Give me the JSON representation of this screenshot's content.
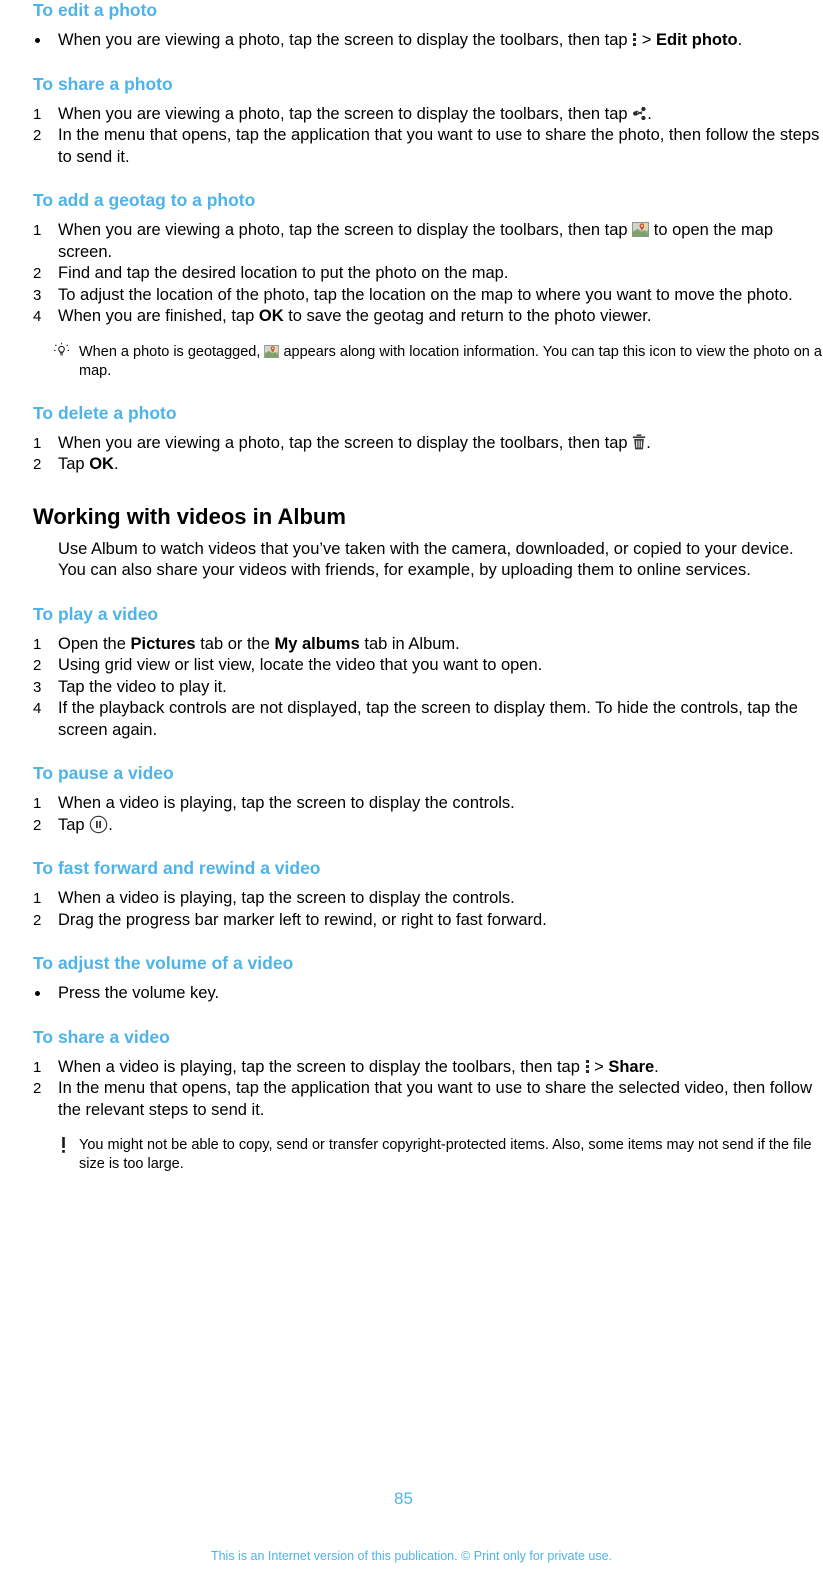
{
  "sections": [
    {
      "id": "edit-photo",
      "heading": "To edit a photo",
      "items": [
        {
          "marker": "bullet",
          "segments": [
            {
              "t": "text",
              "v": "When you are viewing a photo, tap the screen to display the toolbars, then tap "
            },
            {
              "t": "icon",
              "v": "kebab-menu-icon"
            },
            {
              "t": "text",
              "v": " > "
            },
            {
              "t": "bold",
              "v": "Edit photo"
            },
            {
              "t": "text",
              "v": "."
            }
          ]
        }
      ]
    },
    {
      "id": "share-photo",
      "heading": "To share a photo",
      "items": [
        {
          "marker": "1",
          "segments": [
            {
              "t": "text",
              "v": "When you are viewing a photo, tap the screen to display the toolbars, then tap "
            },
            {
              "t": "icon",
              "v": "share-icon"
            },
            {
              "t": "text",
              "v": "."
            }
          ]
        },
        {
          "marker": "2",
          "segments": [
            {
              "t": "text",
              "v": "In the menu that opens, tap the application that you want to use to share the photo, then follow the steps to send it."
            }
          ]
        }
      ]
    },
    {
      "id": "geotag-photo",
      "heading": "To add a geotag to a photo",
      "items": [
        {
          "marker": "1",
          "segments": [
            {
              "t": "text",
              "v": "When you are viewing a photo, tap the screen to display the toolbars, then tap "
            },
            {
              "t": "icon",
              "v": "map-pin-icon"
            },
            {
              "t": "text",
              "v": " to open the map screen."
            }
          ]
        },
        {
          "marker": "2",
          "segments": [
            {
              "t": "text",
              "v": "Find and tap the desired location to put the photo on the map."
            }
          ]
        },
        {
          "marker": "3",
          "segments": [
            {
              "t": "text",
              "v": "To adjust the location of the photo, tap the location on the map to where you want to move the photo."
            }
          ]
        },
        {
          "marker": "4",
          "segments": [
            {
              "t": "text",
              "v": "When you are finished, tap "
            },
            {
              "t": "bold",
              "v": "OK"
            },
            {
              "t": "text",
              "v": " to save the geotag and return to the photo viewer."
            }
          ]
        }
      ],
      "note": {
        "type": "tip",
        "glyph": "lightbulb-icon",
        "segments": [
          {
            "t": "text",
            "v": "When a photo is geotagged, "
          },
          {
            "t": "icon",
            "v": "map-pin-icon-small"
          },
          {
            "t": "text",
            "v": " appears along with location information. You can tap this icon to view the photo on a map."
          }
        ]
      }
    },
    {
      "id": "delete-photo",
      "heading": "To delete a photo",
      "items": [
        {
          "marker": "1",
          "segments": [
            {
              "t": "text",
              "v": "When you are viewing a photo, tap the screen to display the toolbars, then tap "
            },
            {
              "t": "icon",
              "v": "trash-icon"
            },
            {
              "t": "text",
              "v": "."
            }
          ]
        },
        {
          "marker": "2",
          "segments": [
            {
              "t": "text",
              "v": "Tap "
            },
            {
              "t": "bold",
              "v": "OK"
            },
            {
              "t": "text",
              "v": "."
            }
          ]
        }
      ]
    }
  ],
  "chapter": {
    "title": "Working with videos in Album",
    "intro": "Use Album to watch videos that you’ve taken with the camera, downloaded, or copied to your device. You can also share your videos with friends, for example, by uploading them to online services."
  },
  "video_sections": [
    {
      "id": "play-video",
      "heading": "To play a video",
      "items": [
        {
          "marker": "1",
          "segments": [
            {
              "t": "text",
              "v": "Open the "
            },
            {
              "t": "bold",
              "v": "Pictures"
            },
            {
              "t": "text",
              "v": " tab or the "
            },
            {
              "t": "bold",
              "v": "My albums"
            },
            {
              "t": "text",
              "v": " tab in Album."
            }
          ]
        },
        {
          "marker": "2",
          "segments": [
            {
              "t": "text",
              "v": "Using grid view or list view, locate the video that you want to open."
            }
          ]
        },
        {
          "marker": "3",
          "segments": [
            {
              "t": "text",
              "v": "Tap the video to play it."
            }
          ]
        },
        {
          "marker": "4",
          "segments": [
            {
              "t": "text",
              "v": "If the playback controls are not displayed, tap the screen to display them. To hide the controls, tap the screen again."
            }
          ]
        }
      ]
    },
    {
      "id": "pause-video",
      "heading": "To pause a video",
      "items": [
        {
          "marker": "1",
          "segments": [
            {
              "t": "text",
              "v": "When a video is playing, tap the screen to display the controls."
            }
          ]
        },
        {
          "marker": "2",
          "segments": [
            {
              "t": "text",
              "v": "Tap "
            },
            {
              "t": "icon",
              "v": "pause-icon"
            },
            {
              "t": "text",
              "v": "."
            }
          ]
        }
      ]
    },
    {
      "id": "fast-forward-rewind",
      "heading": "To fast forward and rewind a video",
      "items": [
        {
          "marker": "1",
          "segments": [
            {
              "t": "text",
              "v": "When a video is playing, tap the screen to display the controls."
            }
          ]
        },
        {
          "marker": "2",
          "segments": [
            {
              "t": "text",
              "v": "Drag the progress bar marker left to rewind, or right to fast forward."
            }
          ]
        }
      ]
    },
    {
      "id": "adjust-volume",
      "heading": "To adjust the volume of a video",
      "items": [
        {
          "marker": "bullet",
          "segments": [
            {
              "t": "text",
              "v": "Press the volume key."
            }
          ]
        }
      ]
    },
    {
      "id": "share-video",
      "heading": "To share a video",
      "items": [
        {
          "marker": "1",
          "segments": [
            {
              "t": "text",
              "v": "When a video is playing, tap the screen to display the toolbars, then tap "
            },
            {
              "t": "icon",
              "v": "kebab-menu-icon"
            },
            {
              "t": "text",
              "v": " > "
            },
            {
              "t": "bold",
              "v": "Share"
            },
            {
              "t": "text",
              "v": "."
            }
          ]
        },
        {
          "marker": "2",
          "segments": [
            {
              "t": "text",
              "v": "In the menu that opens, tap the application that you want to use to share the selected video, then follow the relevant steps to send it."
            }
          ]
        }
      ],
      "note": {
        "type": "warning",
        "glyph": "exclamation-icon",
        "segments": [
          {
            "t": "text",
            "v": "You might not be able to copy, send or transfer copyright-protected items. Also, some items may not send if the file size is too large."
          }
        ]
      }
    }
  ],
  "footer": {
    "page_number": "85",
    "disclaimer": "This is an Internet version of this publication. © Print only for private use."
  },
  "colors": {
    "heading_blue": "#4eb3e8",
    "text_black": "#000000"
  }
}
